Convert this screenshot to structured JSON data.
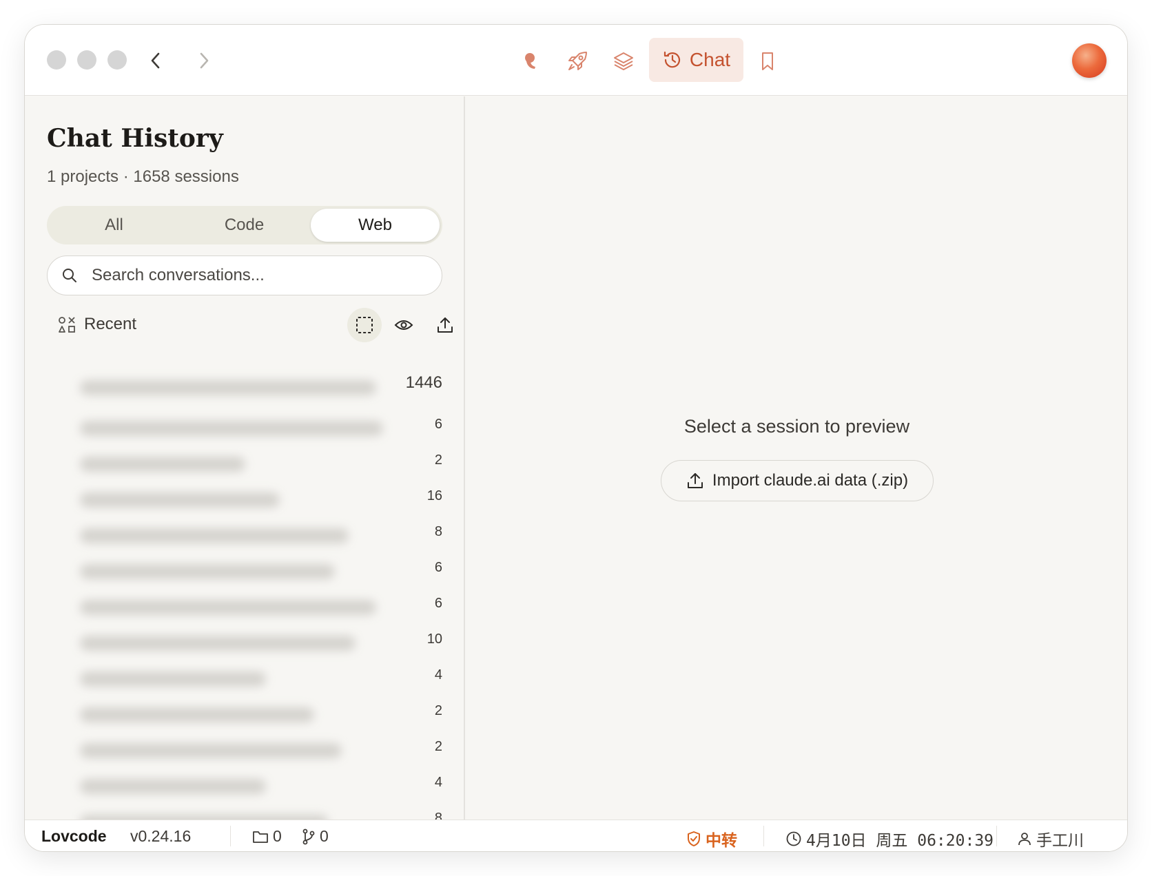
{
  "toolbar": {
    "chat_label": "Chat",
    "icons": [
      "mascot-icon",
      "rocket-icon",
      "layers-icon",
      "history-icon",
      "bookmark-icon"
    ],
    "accent_color": "#c4522f"
  },
  "sidebar": {
    "title": "Chat History",
    "subtitle": "1 projects · 1658 sessions",
    "segments": [
      {
        "label": "All",
        "active": false
      },
      {
        "label": "Code",
        "active": false
      },
      {
        "label": "Web",
        "active": true
      }
    ],
    "search": {
      "placeholder": "Search conversations...",
      "value": ""
    },
    "recent_label": "Recent",
    "rows": [
      {
        "count": "1446"
      },
      {
        "count": "6"
      },
      {
        "count": "2"
      },
      {
        "count": "16"
      },
      {
        "count": "8"
      },
      {
        "count": "6"
      },
      {
        "count": "6"
      },
      {
        "count": "10"
      },
      {
        "count": "4"
      },
      {
        "count": "2"
      },
      {
        "count": "2"
      },
      {
        "count": "4"
      },
      {
        "count": "8"
      }
    ]
  },
  "main": {
    "empty_text": "Select a session to preview",
    "import_label": "Import claude.ai data (.zip)"
  },
  "statusbar": {
    "app_name": "Lovcode",
    "version": "v0.24.16",
    "folder_count": "0",
    "branch_count": "0",
    "relay_label": "中转",
    "relay_color": "#d9631e",
    "datetime": "4月10日 周五 06:20:39",
    "user": "手工川"
  }
}
